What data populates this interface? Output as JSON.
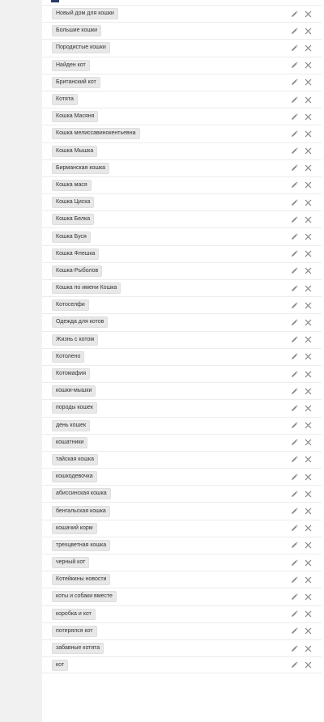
{
  "colors": {
    "tag_bg": "#e8e8e8",
    "icon": "#8a8a8a",
    "sidebar": "#f1f1f1"
  },
  "icons": {
    "edit": "pencil-icon",
    "delete": "close-icon"
  },
  "tags": [
    "Новый дом для кошки",
    "Большие кошки",
    "Породистые кошки",
    "Найден кот",
    "Британский кот",
    "Котята",
    "Кошка Масяня",
    "Кошка мелиссавинокентьевна",
    "Кошка Мышка",
    "Бирманская кошка",
    "Кошка мася",
    "Кошка Циска",
    "Кошка Белка",
    "Кошка Буся",
    "Кошка Флешка",
    "Кошка-Рыболов",
    "Кошка по имени Кошка",
    "Котоселфи",
    "Одежда для котов",
    "Жизнь с котом",
    "Котолено",
    "Котомафия",
    "кошки-мышки",
    "породы кошек",
    "день кошек",
    "кошатники",
    "тайская кошка",
    "кошкодевочка",
    "абиссинская кошка",
    "бенгальская кошка",
    "кошачий корм",
    "трехцветная кошка",
    "черный кот",
    "Котейкины новости",
    "коты и собаки вместе",
    "коробка и кот",
    "потерялся кот",
    "забавные котята",
    "кот"
  ]
}
